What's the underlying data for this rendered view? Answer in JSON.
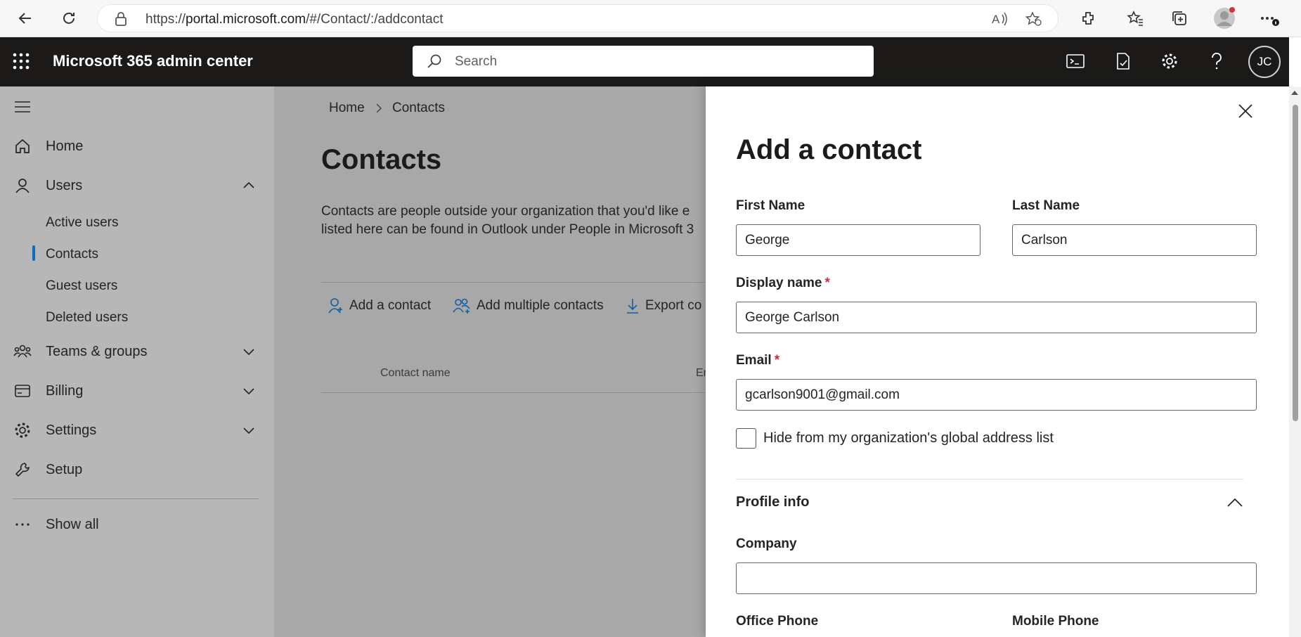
{
  "browser": {
    "url_prefix": "https://",
    "url_host": "portal.microsoft.com",
    "url_path": "/#/Contact/:/addcontact"
  },
  "header": {
    "app_name": "Microsoft 365 admin center",
    "search_placeholder": "Search",
    "avatar_initials": "JC",
    "avatar_color": "#1b1a19"
  },
  "nav": {
    "items": [
      {
        "label": "Home",
        "icon": "home-icon"
      },
      {
        "label": "Users",
        "icon": "person-icon",
        "expanded": true
      },
      {
        "label": "Teams & groups",
        "icon": "teams-icon",
        "expanded": false
      },
      {
        "label": "Billing",
        "icon": "billing-icon",
        "expanded": false
      },
      {
        "label": "Settings",
        "icon": "gear-icon",
        "expanded": false
      },
      {
        "label": "Setup",
        "icon": "wrench-icon"
      },
      {
        "label": "Show all",
        "icon": "ellipsis-icon"
      }
    ],
    "users_sub": [
      "Active users",
      "Contacts",
      "Guest users",
      "Deleted users"
    ],
    "active_sub": "Contacts",
    "accent": "#0f6cbd"
  },
  "main": {
    "breadcrumb": [
      "Home",
      "Contacts"
    ],
    "title": "Contacts",
    "description_line1": "Contacts are people outside your organization that you'd like e",
    "description_line2": "listed here can be found in Outlook under People in Microsoft 3",
    "commands": [
      "Add a contact",
      "Add multiple contacts",
      "Export co"
    ],
    "columns": [
      "Contact name",
      "En"
    ]
  },
  "panel": {
    "title": "Add a contact",
    "first_name_label": "First Name",
    "first_name_value": "George",
    "last_name_label": "Last Name",
    "last_name_value": "Carlson",
    "display_name_label": "Display name",
    "display_name_value": "George Carlson",
    "email_label": "Email",
    "email_value": "gcarlson9001@gmail.com",
    "required_mark": "*",
    "hide_label": "Hide from my organization's global address list",
    "hide_checked": false,
    "section_title": "Profile info",
    "company_label": "Company",
    "company_value": "",
    "office_phone_label": "Office Phone",
    "mobile_phone_label": "Mobile Phone"
  }
}
